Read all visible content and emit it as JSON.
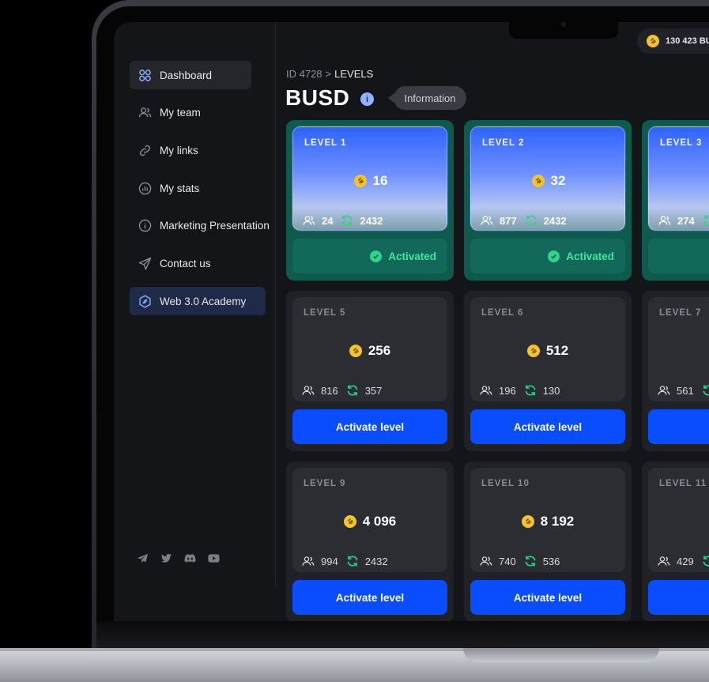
{
  "sidebar": {
    "items": [
      {
        "label": "Dashboard",
        "icon": "grid-icon"
      },
      {
        "label": "My team",
        "icon": "users-icon"
      },
      {
        "label": "My links",
        "icon": "link-icon"
      },
      {
        "label": "My stats",
        "icon": "chart-icon"
      },
      {
        "label": "Marketing Presentation",
        "icon": "info-circle-icon"
      },
      {
        "label": "Contact us",
        "icon": "send-icon"
      },
      {
        "label": "Web 3.0 Academy",
        "icon": "compass-icon"
      }
    ],
    "socials": [
      "telegram-icon",
      "twitter-icon",
      "discord-icon",
      "youtube-icon"
    ]
  },
  "header": {
    "balance": "130 423 BU",
    "breadcrumb_id": "ID 4728",
    "breadcrumb_sep": ">",
    "breadcrumb_current": "LEVELS",
    "title": "BUSD",
    "info_icon": "i",
    "info_tooltip": "Information"
  },
  "levels": [
    {
      "label": "LEVEL 1",
      "price": "16",
      "partners": "24",
      "cycles": "2432",
      "status": "Activated"
    },
    {
      "label": "LEVEL 2",
      "price": "32",
      "partners": "877",
      "cycles": "2432",
      "status": "Activated"
    },
    {
      "label": "LEVEL 3",
      "price": "",
      "partners": "274",
      "cycles": "",
      "status": ""
    },
    {
      "label": "LEVEL 5",
      "price": "256",
      "partners": "816",
      "cycles": "357",
      "button": "Activate level"
    },
    {
      "label": "LEVEL 6",
      "price": "512",
      "partners": "196",
      "cycles": "130",
      "button": "Activate level"
    },
    {
      "label": "LEVEL 7",
      "price": "",
      "partners": "561",
      "cycles": "",
      "button": "Acti"
    },
    {
      "label": "LEVEL 9",
      "price": "4 096",
      "partners": "994",
      "cycles": "2432",
      "button": "Activate level"
    },
    {
      "label": "LEVEL 10",
      "price": "8 192",
      "partners": "740",
      "cycles": "536",
      "button": "Activate level"
    },
    {
      "label": "LEVEL 11",
      "price": "",
      "partners": "429",
      "cycles": "",
      "button": "Acti"
    }
  ],
  "colors": {
    "accent": "#0a4dff",
    "activated": "#2fd38d",
    "coin": "#f5c22f"
  }
}
